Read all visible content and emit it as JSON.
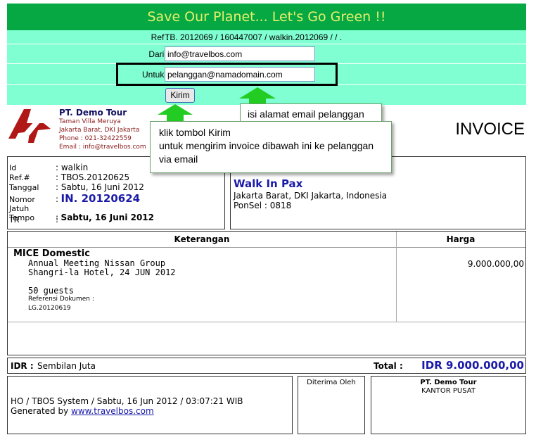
{
  "banner": {
    "title": "Save Our Planet... Let's Go Green !!"
  },
  "email_form": {
    "ref_label": "Ref :",
    "ref_value": "TB. 2012069 / 160447007 / walkin.2012069 / / .",
    "from_label": "Dari :",
    "from_value": "info@travelbos.com",
    "to_label": "Untuk :",
    "to_value": "pelanggan@namadomain.com",
    "send_button": "Kirim"
  },
  "callouts": {
    "email_hint": "isi alamat email pelanggan",
    "send_hint_1": "klik tombol Kirim",
    "send_hint_2": "untuk mengirim invoice dibawah ini ke pelanggan",
    "send_hint_3": "via email"
  },
  "company": {
    "name": "PT. Demo Tour",
    "address1": "Taman Villa Meruya",
    "address2": "Jakarta Barat, DKI Jakarta",
    "phone": "Phone : 021-32422559",
    "email": "Email : info@travelbos.com"
  },
  "invoice_title": "INVOICE",
  "invoice_info": {
    "id_label": "Id",
    "id_value": ": walkin",
    "ref_label": "Ref.#",
    "ref_value": ": TBOS.20120625",
    "date_label": "Tanggal",
    "date_value": ": Sabtu, 16 Juni 2012",
    "number_label": "Nomor",
    "number_prefix": ":",
    "number_value": "IN. 20120624",
    "due_label": "Jatuh Tempo",
    "due_prefix": ":",
    "due_value": "Sabtu, 16 Juni 2012",
    "tr_label": "TR",
    "tr_value": ":"
  },
  "customer": {
    "name": "Walk In Pax",
    "address": "Jakarta Barat, DKI Jakarta, Indonesia",
    "phone": "PonSel : 0818"
  },
  "table": {
    "col_desc": "Keterangan",
    "col_price": "Harga",
    "item_title": "MICE Domestic",
    "item_line1": "Annual Meeting Nissan Group",
    "item_line2": "Shangri-la Hotel, 24 JUN 2012",
    "item_line3": "50 guests",
    "doc_ref_label": "Referensi Dokumen :",
    "doc_ref_value": "LG.20120619",
    "item_price": "9.000.000,00"
  },
  "total": {
    "words_label": "IDR :",
    "words_value": "Sembilan Juta",
    "total_label": "Total :",
    "total_value": "IDR  9.000.000,00"
  },
  "footer": {
    "system_line": "HO / TBOS System / Sabtu, 16 Jun 2012 / 03:07:21 WIB",
    "generated_label": "Generated by",
    "generated_link": "www.travelbos.com",
    "received_label": "Diterima Oleh",
    "company_name": "PT. Demo Tour",
    "company_office": "KANTOR PUSAT"
  },
  "colors": {
    "banner_bg": "#06a843",
    "banner_text": "#e6f06a",
    "form_bg": "#80ffd2",
    "arrow": "#22cc22",
    "accent_blue": "#1a1aa8"
  }
}
